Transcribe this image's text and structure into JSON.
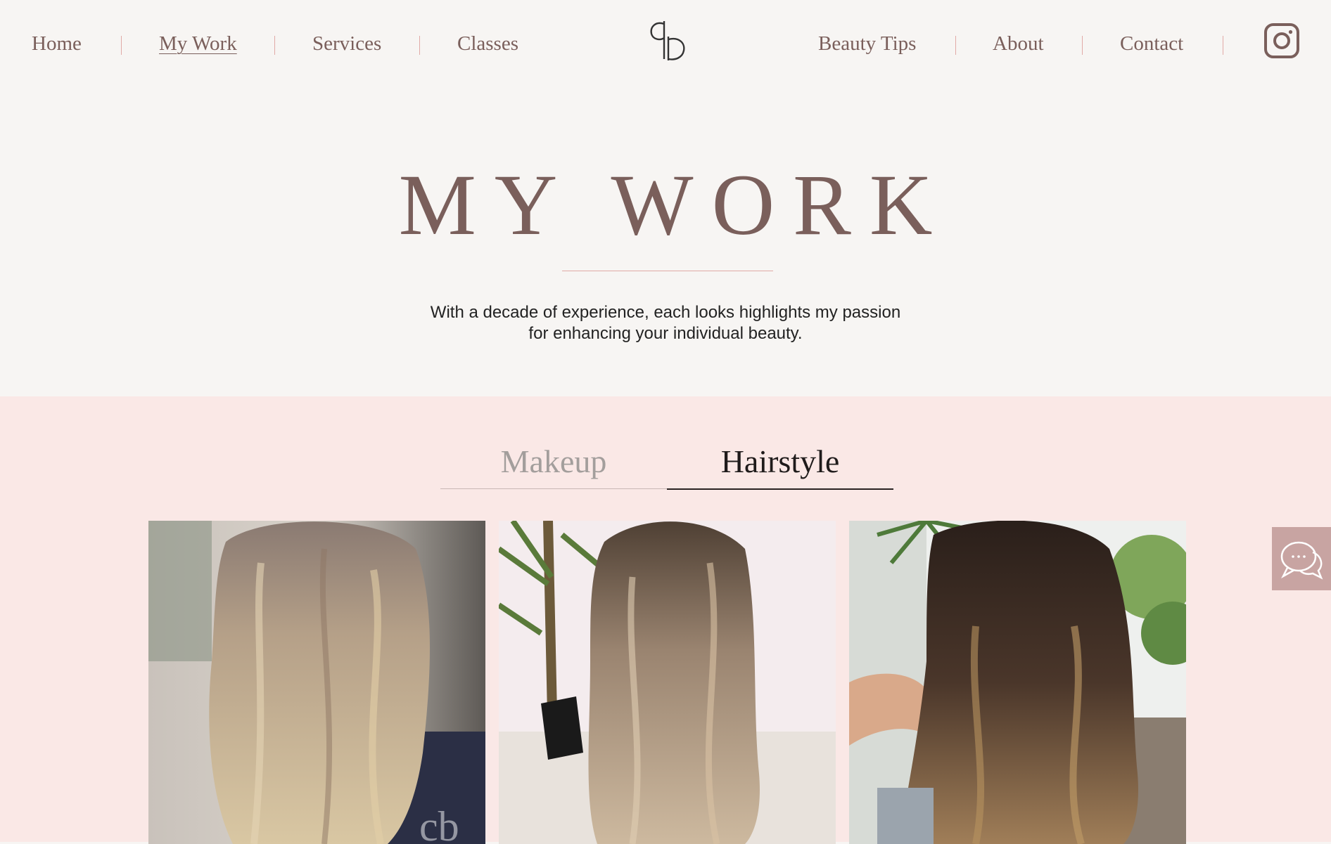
{
  "nav": {
    "left_items": [
      {
        "label": "Home"
      },
      {
        "label": "My Work"
      },
      {
        "label": "Services"
      },
      {
        "label": "Classes"
      }
    ],
    "right_items": [
      {
        "label": "Beauty Tips"
      },
      {
        "label": "About"
      },
      {
        "label": "Contact"
      }
    ],
    "logo_icon": "cb-monogram-logo",
    "social_icon": "instagram-icon"
  },
  "hero": {
    "title": "MY WORK",
    "text_line_1": "With a decade of experience, each looks highlights my passion",
    "text_line_2": "for enhancing your individual beauty."
  },
  "gallery": {
    "tabs": [
      {
        "label": "Makeup",
        "selected": false
      },
      {
        "label": "Hairstyle",
        "selected": true
      }
    ],
    "photos": [
      {
        "subject": "blonde-balayage-wavy-hair-photo"
      },
      {
        "subject": "ash-brown-highlights-wavy-hair-photo"
      },
      {
        "subject": "dark-brown-balayage-curly-hair-photo"
      }
    ]
  },
  "chat": {
    "icon": "chat-bubbles-icon"
  },
  "colors": {
    "accent": "#7a5f5b",
    "divider": "#e1aaa6",
    "section_bg": "#fae8e6",
    "page_bg": "#f7f5f3",
    "chat_bg": "#c8a4a2"
  }
}
